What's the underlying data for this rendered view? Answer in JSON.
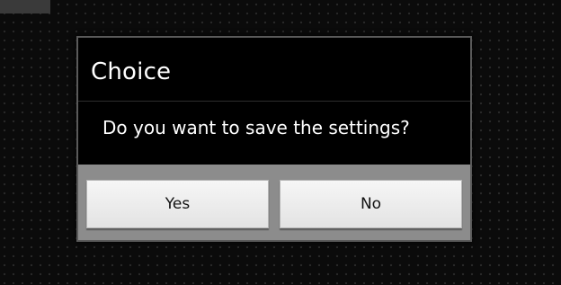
{
  "dialog": {
    "title": "Choice",
    "message": "Do you want to save the settings?",
    "buttons": {
      "yes_label": "Yes",
      "no_label": "No"
    }
  },
  "colors": {
    "dialog_background": "#000000",
    "button_bar": "#8c8c8c",
    "button_face": "#ececec",
    "page_background": "#0b0b0b"
  }
}
